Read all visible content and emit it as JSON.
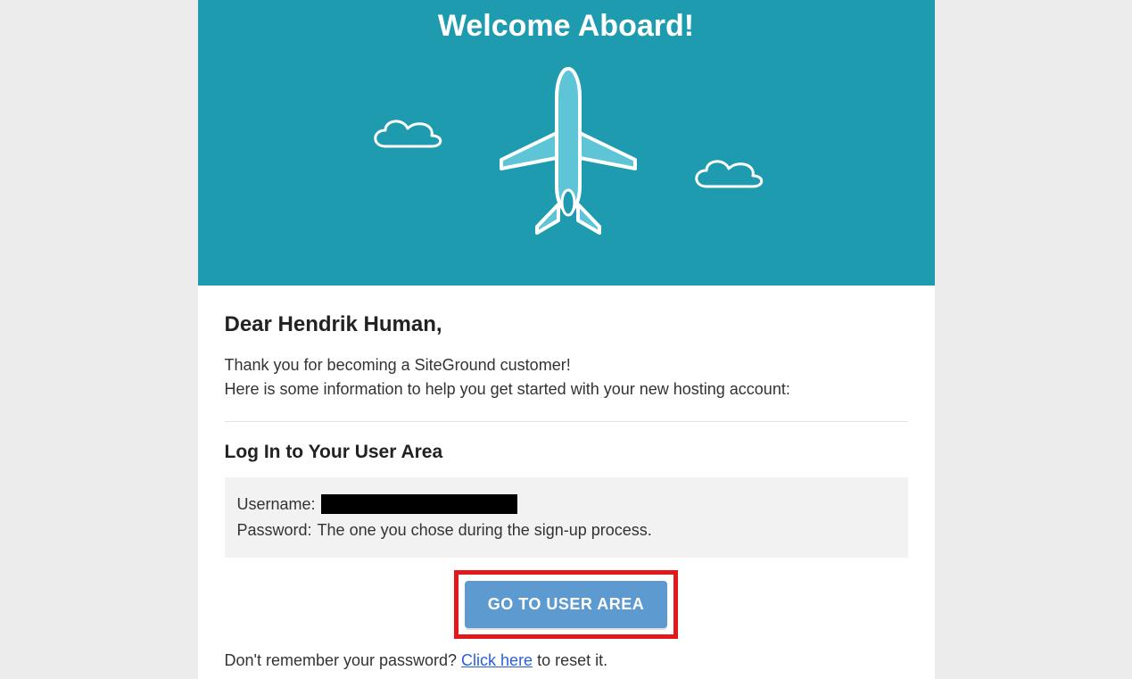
{
  "header": {
    "title": "Welcome Aboard!"
  },
  "greeting": "Dear Hendrik Human,",
  "intro_line1": "Thank you for becoming a SiteGround customer!",
  "intro_line2": "Here is some information to help you get started with your new hosting account:",
  "login_section": {
    "title": "Log In to Your User Area",
    "username_label": "Username:",
    "password_label": "Password:",
    "password_value": "The one you chose during the sign-up process."
  },
  "cta": {
    "label": "GO TO USER AREA"
  },
  "forgot": {
    "prefix": "Don't remember your password? ",
    "link_text": "Click here",
    "suffix": " to reset it."
  }
}
